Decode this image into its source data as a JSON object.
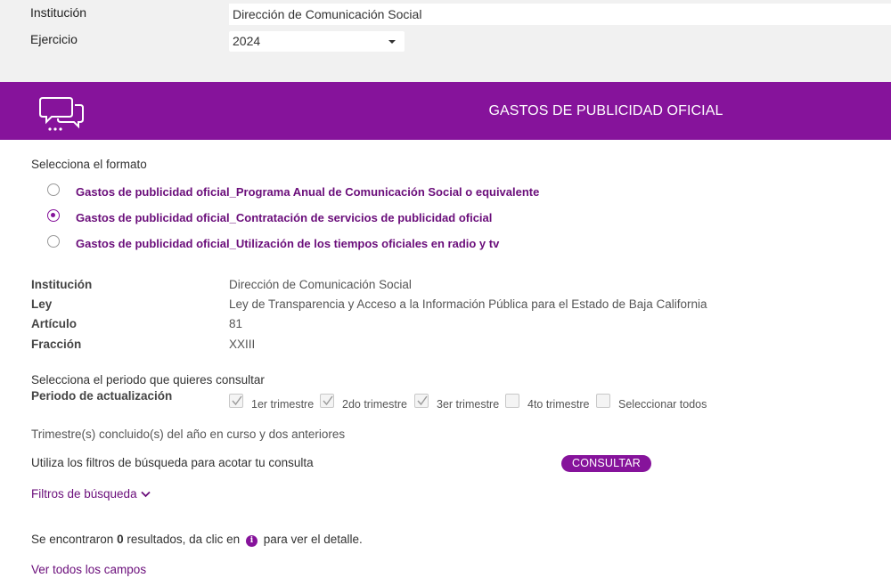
{
  "filters": {
    "institution_label": "Institución",
    "institution_value": "Dirección de Comunicación Social",
    "year_label": "Ejercicio",
    "year_value": "2024"
  },
  "banner": {
    "title": "GASTOS DE PUBLICIDAD OFICIAL",
    "icon": "chat-bubbles-icon",
    "color": "#86139b"
  },
  "format": {
    "prompt": "Selecciona el formato",
    "options": [
      {
        "label": "Gastos de publicidad oficial_Programa Anual de Comunicación Social o equivalente",
        "selected": false
      },
      {
        "label": "Gastos de publicidad oficial_Contratación de servicios de publicidad oficial",
        "selected": true
      },
      {
        "label": "Gastos de publicidad oficial_Utilización de los tiempos oficiales en radio y tv",
        "selected": false
      }
    ]
  },
  "details": [
    {
      "key": "Institución",
      "value": "Dirección de Comunicación Social"
    },
    {
      "key": "Ley",
      "value": "Ley de Transparencia y Acceso a la Información Pública para el Estado de Baja California"
    },
    {
      "key": "Artículo",
      "value": "81"
    },
    {
      "key": "Fracción",
      "value": "XXIII"
    }
  ],
  "period": {
    "prompt": "Selecciona el periodo que quieres consultar",
    "label": "Periodo de actualización",
    "options": [
      {
        "label": "1er trimestre",
        "checked": true
      },
      {
        "label": "2do trimestre",
        "checked": true
      },
      {
        "label": "3er trimestre",
        "checked": true
      },
      {
        "label": "4to trimestre",
        "checked": false
      },
      {
        "label": "Seleccionar todos",
        "checked": false
      }
    ],
    "note": "Trimestre(s) concluido(s) del año en curso y dos anteriores"
  },
  "search": {
    "hint": "Utiliza los filtros de búsqueda para acotar tu consulta",
    "button": "CONSULTAR",
    "filters_link": "Filtros de búsqueda"
  },
  "results": {
    "prefix": "Se encontraron",
    "count": "0",
    "middle": "resultados, da clic en",
    "suffix": "para ver el detalle.",
    "view_all": "Ver todos los campos"
  }
}
